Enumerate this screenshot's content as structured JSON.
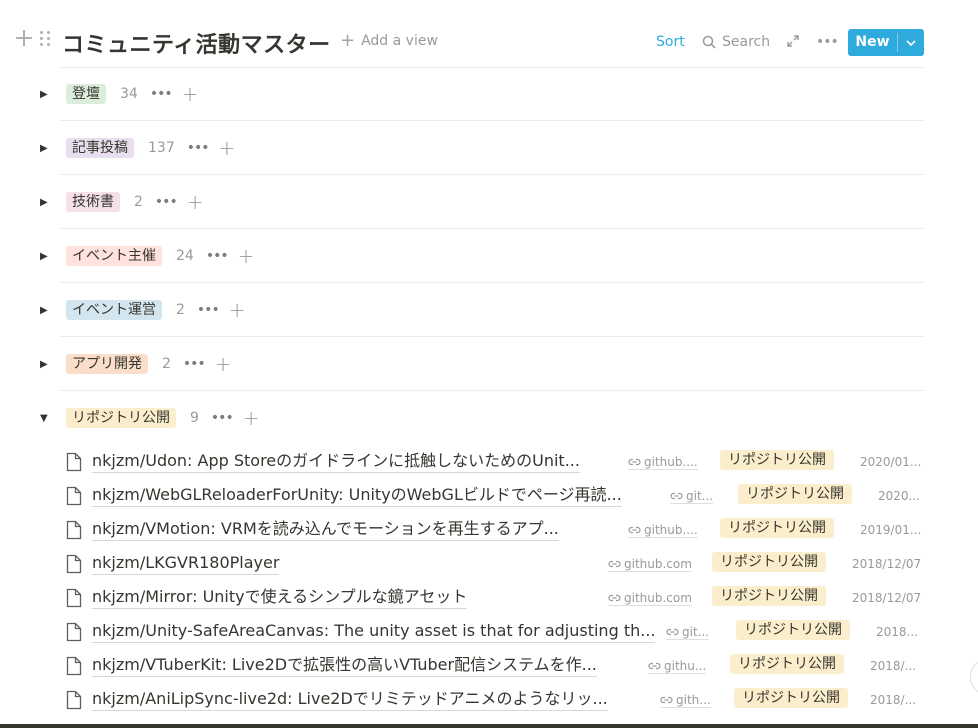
{
  "header": {
    "title": "コミュニティ活動マスター",
    "add_view": "Add a view",
    "sort": "Sort",
    "search": "Search",
    "new_button": "New"
  },
  "groups": [
    {
      "label": "登壇",
      "count": "34",
      "color": "#dbeddb",
      "expanded": false
    },
    {
      "label": "記事投稿",
      "count": "137",
      "color": "#e8deee",
      "expanded": false
    },
    {
      "label": "技術書",
      "count": "2",
      "color": "#f5e0e9",
      "expanded": false
    },
    {
      "label": "イベント主催",
      "count": "24",
      "color": "#ffe2dd",
      "expanded": false
    },
    {
      "label": "イベント運営",
      "count": "2",
      "color": "#d3e5ef",
      "expanded": false
    },
    {
      "label": "アプリ開発",
      "count": "2",
      "color": "#fadec9",
      "expanded": false
    },
    {
      "label": "リポジトリ公開",
      "count": "9",
      "color": "#fbeecc",
      "expanded": true
    }
  ],
  "rows": [
    {
      "title": "nkjzm/Udon: App Storeのガイドラインに抵触しないためのUnit...",
      "url": "github....",
      "tag": "リポジトリ公開",
      "date": "2020/01..."
    },
    {
      "title": "nkjzm/WebGLReloaderForUnity: UnityのWebGLビルドでページ再読...",
      "url": "git...",
      "tag": "リポジトリ公開",
      "date": "2020..."
    },
    {
      "title": "nkjzm/VMotion: VRMを読み込んでモーションを再生するアプ...",
      "url": "github....",
      "tag": "リポジトリ公開",
      "date": "2019/01..."
    },
    {
      "title": "nkjzm/LKGVR180Player",
      "url": "github.com",
      "tag": "リポジトリ公開",
      "date": "2018/12/07"
    },
    {
      "title": "nkjzm/Mirror: Unityで使えるシンプルな鏡アセット",
      "url": "github.com",
      "tag": "リポジトリ公開",
      "date": "2018/12/07"
    },
    {
      "title": "nkjzm/Unity-SafeAreaCanvas: The unity asset is that for adjusting th...",
      "url": "git...",
      "tag": "リポジトリ公開",
      "date": "2018..."
    },
    {
      "title": "nkjzm/VTuberKit: Live2Dで拡張性の高いVTuber配信システムを作...",
      "url": "githu...",
      "tag": "リポジトリ公開",
      "date": "2018/..."
    },
    {
      "title": "nkjzm/AniLipSync-live2d: Live2Dでリミテッドアニメのようなリッ...",
      "url": "gith...",
      "tag": "リポジトリ公開",
      "date": "2018/..."
    }
  ]
}
